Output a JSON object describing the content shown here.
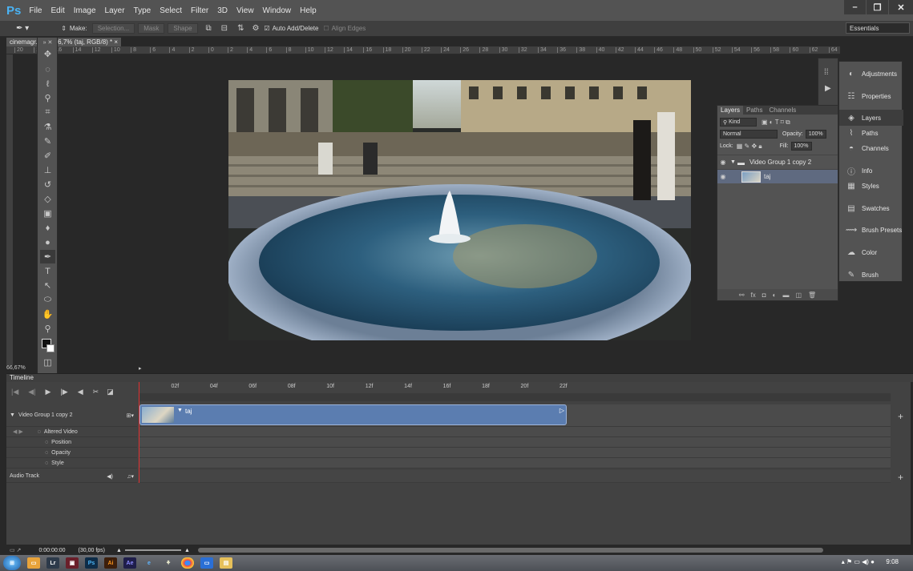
{
  "app": {
    "logo": "Ps"
  },
  "menu": [
    "File",
    "Edit",
    "Image",
    "Layer",
    "Type",
    "Select",
    "Filter",
    "3D",
    "View",
    "Window",
    "Help"
  ],
  "window_controls": {
    "minimize": "–",
    "restore": "❐",
    "close": "✕"
  },
  "options": {
    "make_label": "Make:",
    "selection_btn": "Selection...",
    "mask_btn": "Mask",
    "shape_btn": "Shape",
    "auto_add_delete": "Auto Add/Delete",
    "align_edges": "Align Edges",
    "workspace": "Essentials"
  },
  "doc_tab": {
    "label": "cinemagr... i @ 66,7% (taj, RGB/8) * ×"
  },
  "ruler_ticks": [
    "20",
    "18",
    "16",
    "14",
    "12",
    "10",
    "8",
    "6",
    "4",
    "2",
    "0",
    "2",
    "4",
    "6",
    "8",
    "10",
    "12",
    "14",
    "16",
    "18",
    "20",
    "22",
    "24",
    "26",
    "28",
    "30",
    "32",
    "34",
    "36",
    "38",
    "40",
    "42",
    "44",
    "46",
    "48",
    "50",
    "52",
    "54",
    "56",
    "58",
    "60",
    "62",
    "64"
  ],
  "status": {
    "zoom": "66,67%"
  },
  "layers_panel": {
    "tabs": [
      "Layers",
      "Paths",
      "Channels"
    ],
    "kind_label": "Kind",
    "blend_mode": "Normal",
    "opacity_label": "Opacity:",
    "opacity_value": "100%",
    "lock_label": "Lock:",
    "fill_label": "Fill:",
    "fill_value": "100%",
    "layers": [
      {
        "name": "Video Group 1 copy 2"
      },
      {
        "name": "taj"
      }
    ]
  },
  "dock": [
    {
      "label": "Adjustments",
      "icon": "adjustments-icon"
    },
    {
      "label": "Properties",
      "icon": "properties-icon"
    },
    {
      "label": "Layers",
      "icon": "layers-icon"
    },
    {
      "label": "Paths",
      "icon": "paths-icon"
    },
    {
      "label": "Channels",
      "icon": "channels-icon"
    },
    {
      "label": "Info",
      "icon": "info-icon"
    },
    {
      "label": "Styles",
      "icon": "styles-icon"
    },
    {
      "label": "Swatches",
      "icon": "swatches-icon"
    },
    {
      "label": "Brush Presets",
      "icon": "brush-presets-icon"
    },
    {
      "label": "Color",
      "icon": "color-icon"
    },
    {
      "label": "Brush",
      "icon": "brush-icon"
    }
  ],
  "timeline": {
    "title": "Timeline",
    "ruler": [
      "02f",
      "04f",
      "06f",
      "08f",
      "10f",
      "12f",
      "14f",
      "16f",
      "18f",
      "20f",
      "22f"
    ],
    "group_name": "Video Group 1 copy 2",
    "clip_name": "taj",
    "properties": [
      "Altered Video",
      "Position",
      "Opacity",
      "Style"
    ],
    "audio_track": "Audio Track",
    "timecode": "0:00:00:00",
    "fps": "(30,00 fps)"
  },
  "taskbar": {
    "time": "9:08"
  },
  "colors": {
    "accent": "#4ab3f4",
    "clip": "#5b7db0",
    "playhead": "#e03030",
    "panel": "#535353"
  }
}
